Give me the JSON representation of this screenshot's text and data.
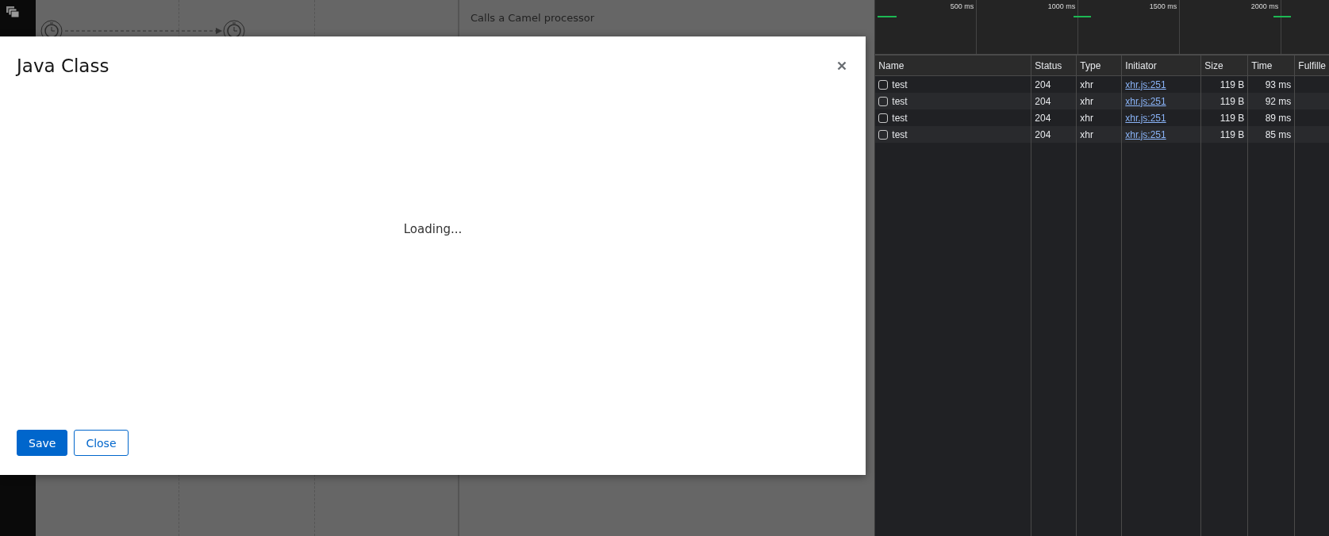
{
  "properties_panel": {
    "description": "Calls a Camel processor"
  },
  "modal": {
    "title": "Java Class",
    "loading_text": "Loading...",
    "buttons": [
      {
        "label": "Save",
        "kind": "primary"
      },
      {
        "label": "Close",
        "kind": "secondary"
      }
    ]
  },
  "devtools": {
    "timeline_ticks": [
      "500 ms",
      "1000 ms",
      "1500 ms",
      "2000 ms"
    ],
    "table": {
      "columns": [
        "Name",
        "Status",
        "Type",
        "Initiator",
        "Size",
        "Time",
        "Fulfille"
      ],
      "rows": [
        {
          "checked": false,
          "name": "test",
          "status": "204",
          "type": "xhr",
          "initiator": "xhr.js:251",
          "size": "119 B",
          "time": "93 ms"
        },
        {
          "checked": false,
          "name": "test",
          "status": "204",
          "type": "xhr",
          "initiator": "xhr.js:251",
          "size": "119 B",
          "time": "92 ms"
        },
        {
          "checked": false,
          "name": "test",
          "status": "204",
          "type": "xhr",
          "initiator": "xhr.js:251",
          "size": "119 B",
          "time": "89 ms"
        },
        {
          "checked": false,
          "name": "test",
          "status": "204",
          "type": "xhr",
          "initiator": "xhr.js:251",
          "size": "119 B",
          "time": "85 ms"
        }
      ]
    }
  }
}
